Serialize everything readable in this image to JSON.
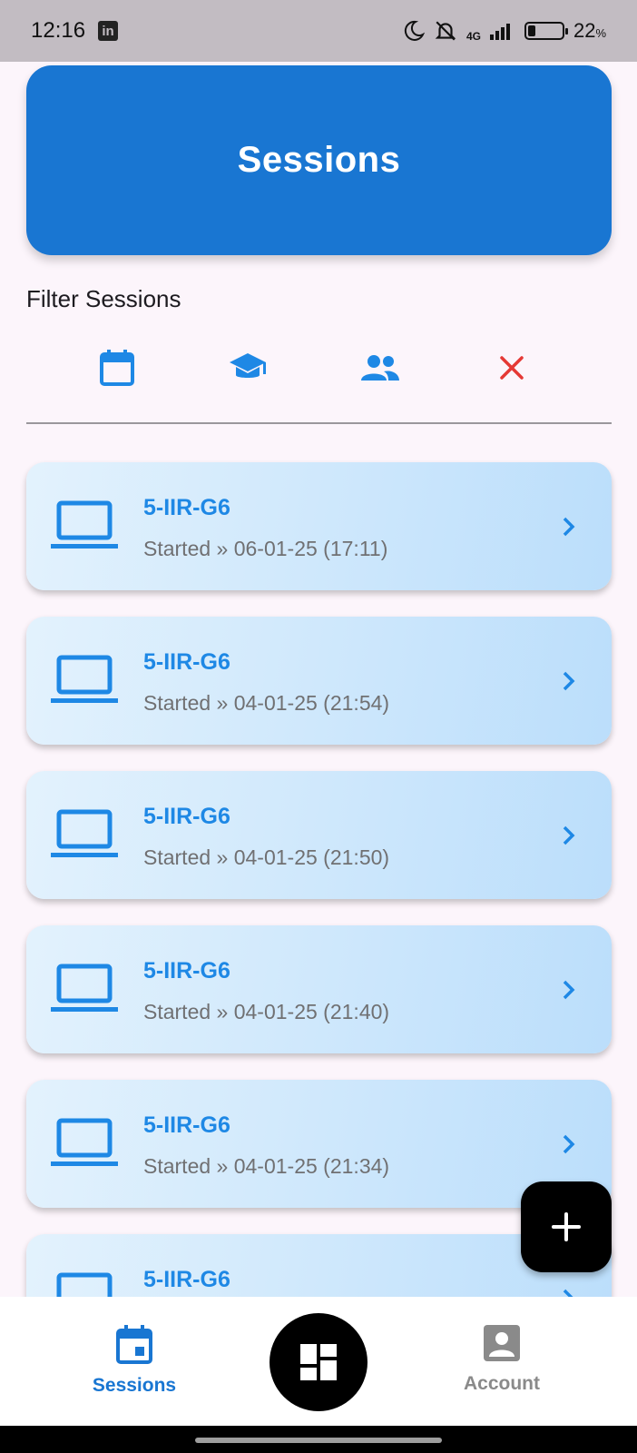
{
  "status_bar": {
    "time": "12:16",
    "network": "4G",
    "battery_percent": "22",
    "battery_unit": "%",
    "battery_level": 0.22
  },
  "header": {
    "title": "Sessions",
    "color": "#1976d2"
  },
  "filter": {
    "title": "Filter Sessions",
    "buttons": [
      {
        "name": "filter-date-button",
        "icon": "calendar-icon",
        "color": "#1e88e5"
      },
      {
        "name": "filter-class-button",
        "icon": "graduation-cap-icon",
        "color": "#1e88e5"
      },
      {
        "name": "filter-group-button",
        "icon": "people-icon",
        "color": "#1e88e5"
      },
      {
        "name": "clear-filter-button",
        "icon": "close-icon",
        "color": "#e53935"
      }
    ]
  },
  "sessions": [
    {
      "name": "5-IIR-G6",
      "meta": "Started » 06-01-25 (17:11)"
    },
    {
      "name": "5-IIR-G6",
      "meta": "Started » 04-01-25 (21:54)"
    },
    {
      "name": "5-IIR-G6",
      "meta": "Started » 04-01-25 (21:50)"
    },
    {
      "name": "5-IIR-G6",
      "meta": "Started » 04-01-25 (21:40)"
    },
    {
      "name": "5-IIR-G6",
      "meta": "Started » 04-01-25 (21:34)"
    },
    {
      "name": "5-IIR-G6",
      "meta": ""
    }
  ],
  "fab": {
    "icon": "plus-icon"
  },
  "bottom_nav": {
    "sessions_label": "Sessions",
    "account_label": "Account",
    "active_color": "#1976d2",
    "inactive_color": "#8a8a8a",
    "center_icon": "dashboard-icon"
  }
}
